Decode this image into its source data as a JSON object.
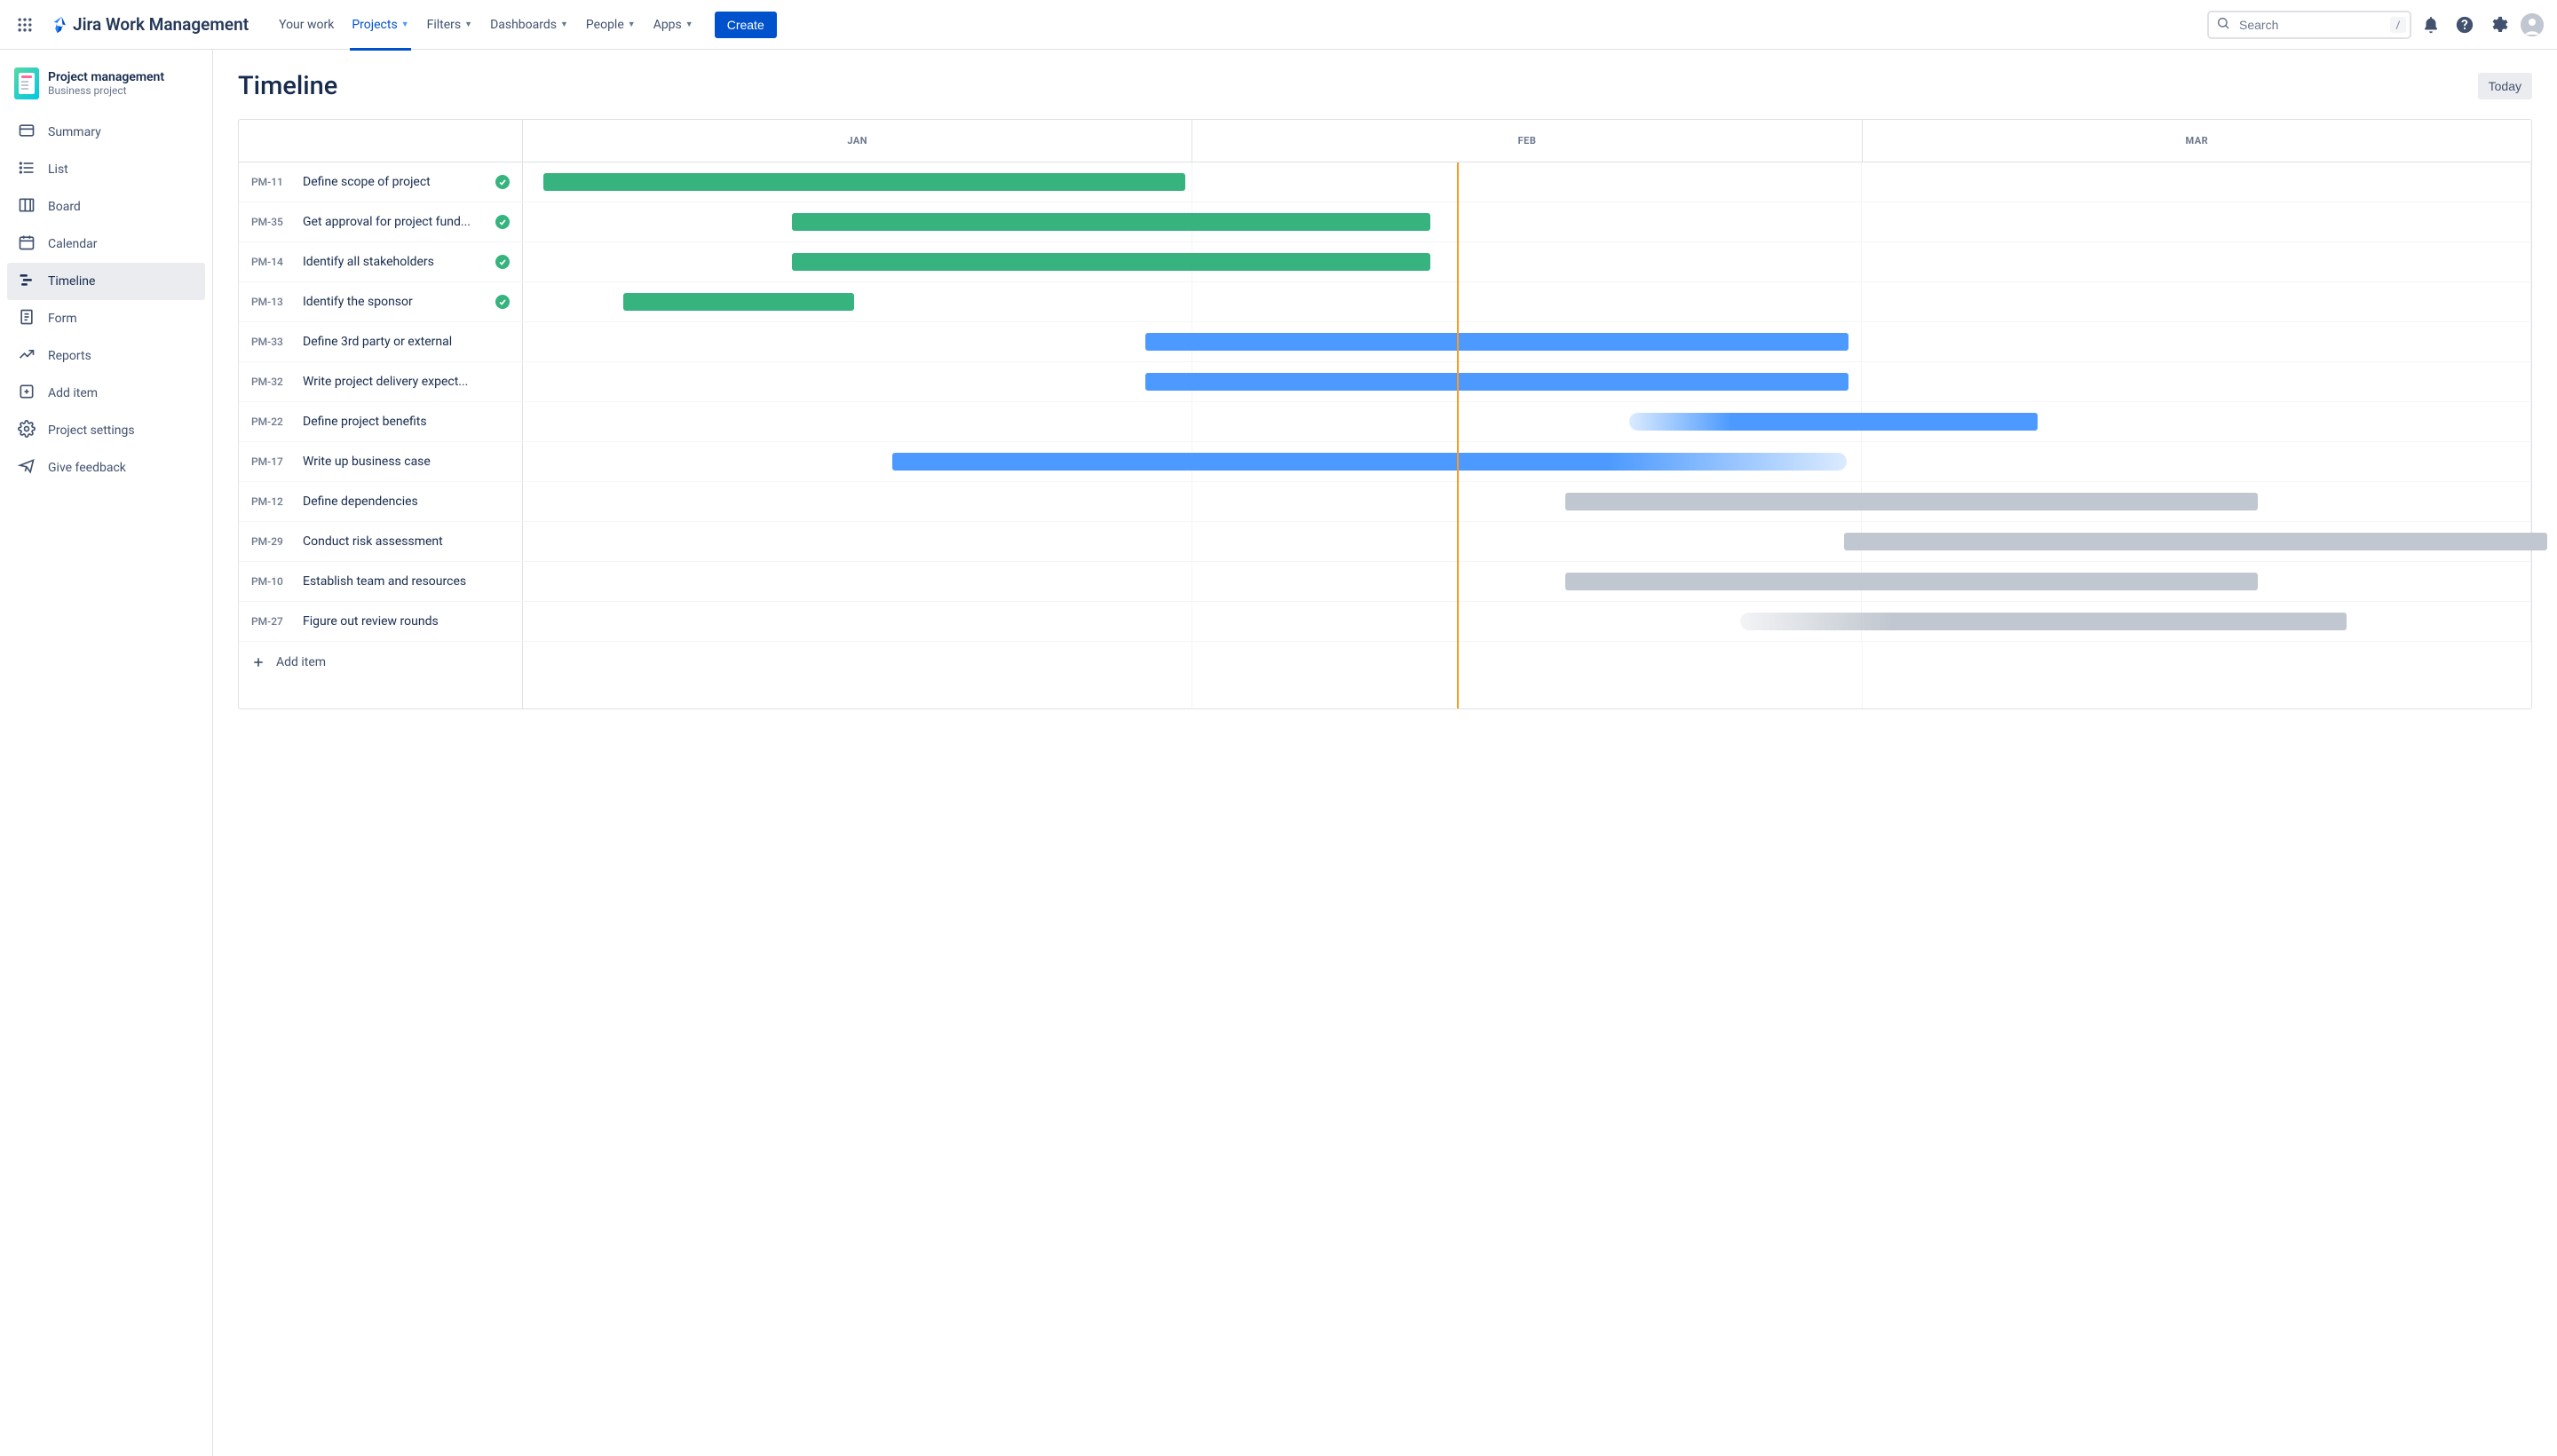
{
  "app_name": "Jira Work Management",
  "header": {
    "nav_items": [
      {
        "label": "Your work",
        "active": false,
        "has_chevron": false
      },
      {
        "label": "Projects",
        "active": true,
        "has_chevron": true
      },
      {
        "label": "Filters",
        "active": false,
        "has_chevron": true
      },
      {
        "label": "Dashboards",
        "active": false,
        "has_chevron": true
      },
      {
        "label": "People",
        "active": false,
        "has_chevron": true
      },
      {
        "label": "Apps",
        "active": false,
        "has_chevron": true
      }
    ],
    "create_label": "Create",
    "search_placeholder": "Search",
    "search_shortcut": "/"
  },
  "project": {
    "name": "Project management",
    "type": "Business project"
  },
  "sidebar_items": [
    {
      "label": "Summary",
      "icon": "summary",
      "active": false
    },
    {
      "label": "List",
      "icon": "list",
      "active": false
    },
    {
      "label": "Board",
      "icon": "board",
      "active": false
    },
    {
      "label": "Calendar",
      "icon": "calendar",
      "active": false
    },
    {
      "label": "Timeline",
      "icon": "timeline",
      "active": true
    },
    {
      "label": "Form",
      "icon": "form",
      "active": false
    },
    {
      "label": "Reports",
      "icon": "reports",
      "active": false
    },
    {
      "label": "Add item",
      "icon": "add-item",
      "active": false
    },
    {
      "label": "Project settings",
      "icon": "settings",
      "active": false
    },
    {
      "label": "Give feedback",
      "icon": "feedback",
      "active": false
    }
  ],
  "page": {
    "title": "Timeline",
    "today_label": "Today",
    "add_item_label": "Add item"
  },
  "timeline": {
    "months": [
      "JAN",
      "FEB",
      "MAR"
    ],
    "today_position_percent": 46.5,
    "rows": [
      {
        "id": "PM-11",
        "title": "Define scope of project",
        "done": true,
        "bar": {
          "start": 1.0,
          "width": 32.0,
          "color": "#36B37E"
        }
      },
      {
        "id": "PM-35",
        "title": "Get approval for project fund...",
        "done": true,
        "bar": {
          "start": 13.4,
          "width": 31.8,
          "color": "#36B37E"
        }
      },
      {
        "id": "PM-14",
        "title": "Identify all stakeholders",
        "done": true,
        "bar": {
          "start": 13.4,
          "width": 31.8,
          "color": "#36B37E"
        }
      },
      {
        "id": "PM-13",
        "title": "Identify the sponsor",
        "done": true,
        "bar": {
          "start": 5.0,
          "width": 11.5,
          "color": "#36B37E"
        }
      },
      {
        "id": "PM-33",
        "title": "Define 3rd party or external",
        "done": false,
        "bar": {
          "start": 31.0,
          "width": 35.0,
          "color": "#4C9AFF"
        }
      },
      {
        "id": "PM-32",
        "title": "Write project delivery expect...",
        "done": false,
        "bar": {
          "start": 31.0,
          "width": 35.0,
          "color": "#4C9AFF"
        }
      },
      {
        "id": "PM-22",
        "title": "Define project benefits",
        "done": false,
        "bar": {
          "start": 55.1,
          "width": 20.3,
          "color": "#4C9AFF",
          "fade_left": true
        }
      },
      {
        "id": "PM-17",
        "title": "Write up business case",
        "done": false,
        "bar": {
          "start": 18.4,
          "width": 47.5,
          "color": "#4C9AFF",
          "fade_right": true
        }
      },
      {
        "id": "PM-12",
        "title": "Define dependencies",
        "done": false,
        "bar": {
          "start": 51.9,
          "width": 34.5,
          "color": "#C1C7D0"
        }
      },
      {
        "id": "PM-29",
        "title": "Conduct risk assessment",
        "done": false,
        "bar": {
          "start": 65.8,
          "width": 35.0,
          "color": "#C1C7D0"
        }
      },
      {
        "id": "PM-10",
        "title": "Establish team and resources",
        "done": false,
        "bar": {
          "start": 51.9,
          "width": 34.5,
          "color": "#C1C7D0"
        }
      },
      {
        "id": "PM-27",
        "title": "Figure out review rounds",
        "done": false,
        "bar": {
          "start": 60.6,
          "width": 30.2,
          "color": "#C1C7D0",
          "fade_left": true
        }
      }
    ]
  }
}
